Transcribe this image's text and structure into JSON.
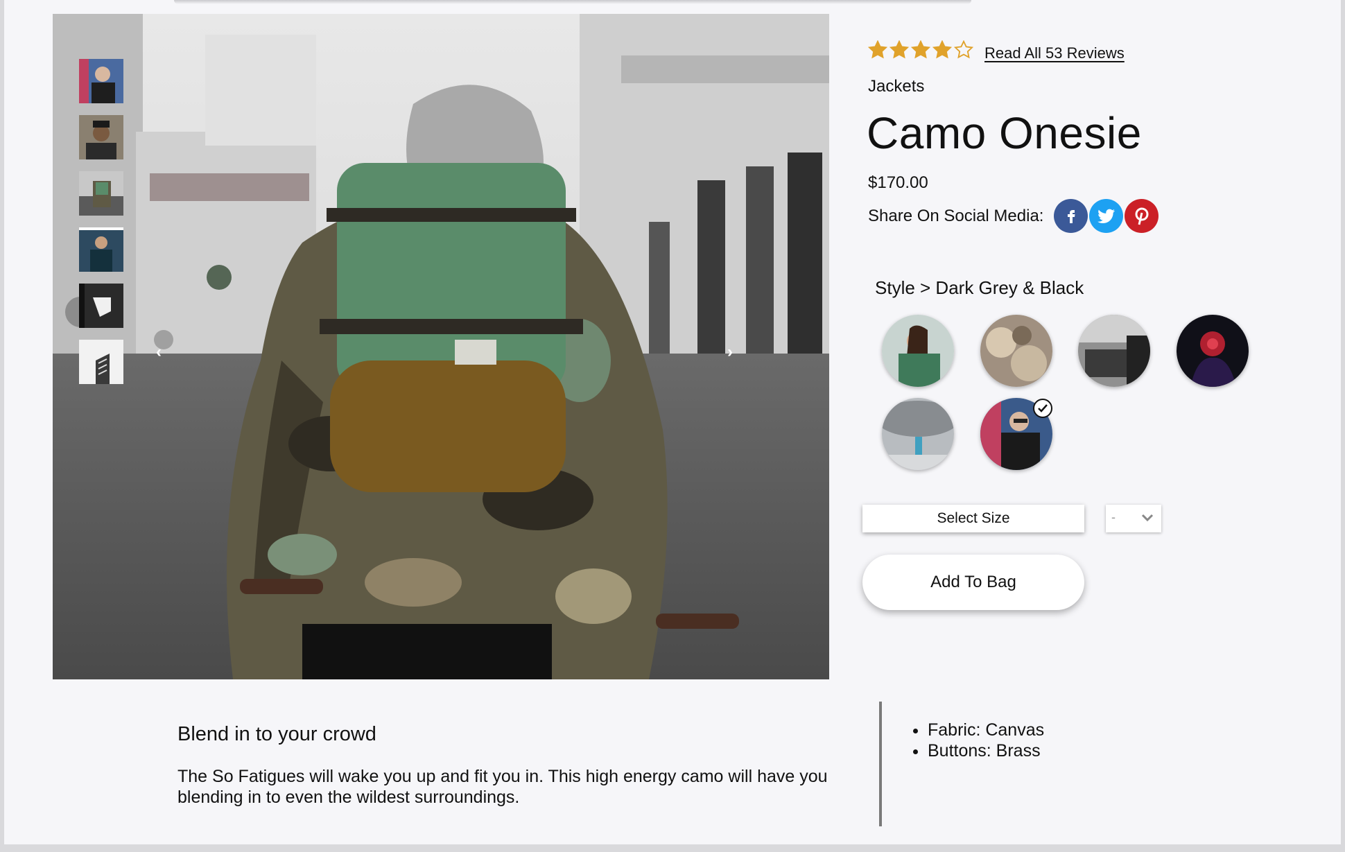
{
  "gallery": {
    "thumbnails": [
      {
        "alt": "thumbnail-1",
        "active": false
      },
      {
        "alt": "thumbnail-2",
        "active": false
      },
      {
        "alt": "thumbnail-3",
        "active": false
      },
      {
        "alt": "thumbnail-4",
        "active": true
      },
      {
        "alt": "thumbnail-5",
        "active": false
      },
      {
        "alt": "thumbnail-6",
        "active": false
      }
    ],
    "prev_icon": "chevron-left-icon",
    "next_icon": "chevron-right-icon"
  },
  "product": {
    "rating": 4,
    "rating_max": 5,
    "reviews_link": "Read All 53 Reviews",
    "category": "Jackets",
    "title": "Camo Onesie",
    "price": "$170.00",
    "share_label": "Share On Social Media:",
    "social": [
      {
        "name": "facebook-icon",
        "color": "#3b5998"
      },
      {
        "name": "twitter-icon",
        "color": "#1da1f2"
      },
      {
        "name": "pinterest-icon",
        "color": "#cb2027"
      }
    ],
    "style_label": "Style > Dark Grey & Black",
    "styles": [
      {
        "name": "style-1",
        "selected": false
      },
      {
        "name": "style-2",
        "selected": false
      },
      {
        "name": "style-3",
        "selected": false
      },
      {
        "name": "style-4",
        "selected": false
      },
      {
        "name": "style-5",
        "selected": false
      },
      {
        "name": "style-6",
        "selected": true
      }
    ],
    "select_size_label": "Select Size",
    "size_value": "-",
    "add_to_bag_label": "Add To Bag"
  },
  "description": {
    "heading": "Blend in to your crowd",
    "body": "The So Fatigues will wake you up and fit you in. This high energy camo will have you blending in to even the wildest surroundings.",
    "features": [
      "Fabric: Canvas",
      "Buttons: Brass"
    ]
  },
  "colors": {
    "star": "#e0a22b",
    "page_bg": "#f6f6f9"
  }
}
